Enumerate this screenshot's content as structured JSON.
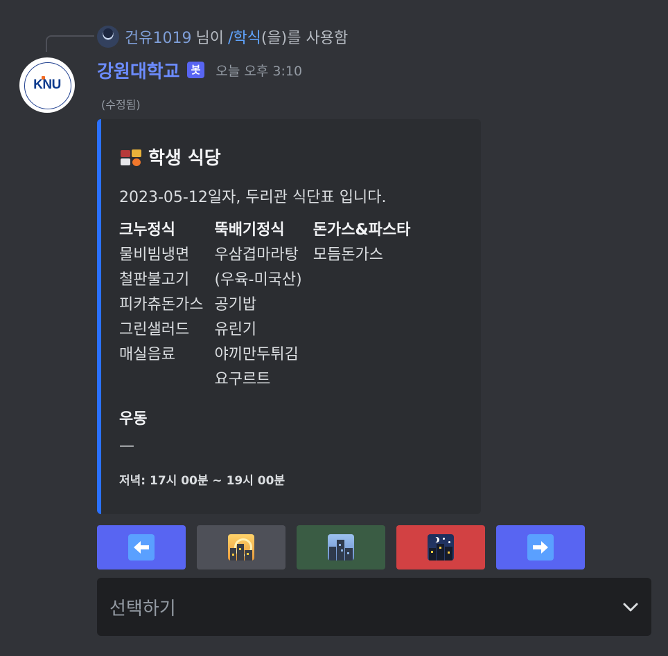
{
  "reply": {
    "user": "건유1019",
    "middle": "님이",
    "command": "/학식",
    "suffix": "(을)를 사용함"
  },
  "message": {
    "author": "강원대학교",
    "badge": "봇",
    "timestamp": "오늘 오후 3:10",
    "edited": "(수정됨)",
    "avatar_text": "KNU",
    "avatar_ring_text": "KANGWON NATIONAL UNIVERSITY"
  },
  "embed": {
    "accent_color": "#2b71ff",
    "title": "학생 식당",
    "title_icon": "bento-box-icon",
    "description": "2023-05-12일자, 두리관 식단표 입니다.",
    "menus": [
      {
        "name": "크누정식",
        "items": [
          "물비빔냉면",
          "철판불고기",
          "피카츄돈가스",
          "그린샐러드",
          "매실음료"
        ]
      },
      {
        "name": "뚝배기정식",
        "items": [
          "우삼겹마라탕",
          "(우육-미국산)",
          "공기밥",
          "유린기",
          "야끼만두튀김",
          "요구르트"
        ]
      },
      {
        "name": "돈가스&파스타",
        "items": [
          "모듬돈가스"
        ]
      }
    ],
    "udong": {
      "name": "우동",
      "value": "—"
    },
    "footer": "저녁: 17시 00분 ~ 19시 00분"
  },
  "buttons": [
    {
      "name": "prev",
      "icon": "left-arrow-icon",
      "glyph": "🡐",
      "color": "#5865f2"
    },
    {
      "name": "morning",
      "icon": "sunrise-over-city-icon",
      "color": "#4e5058"
    },
    {
      "name": "evening",
      "icon": "cityscape-at-dusk-icon",
      "color": "#3a5c44"
    },
    {
      "name": "night",
      "icon": "night-city-icon",
      "color": "#d24143"
    },
    {
      "name": "next",
      "icon": "right-arrow-icon",
      "glyph": "🡒",
      "color": "#5865f2"
    }
  ],
  "select": {
    "placeholder": "선택하기"
  }
}
